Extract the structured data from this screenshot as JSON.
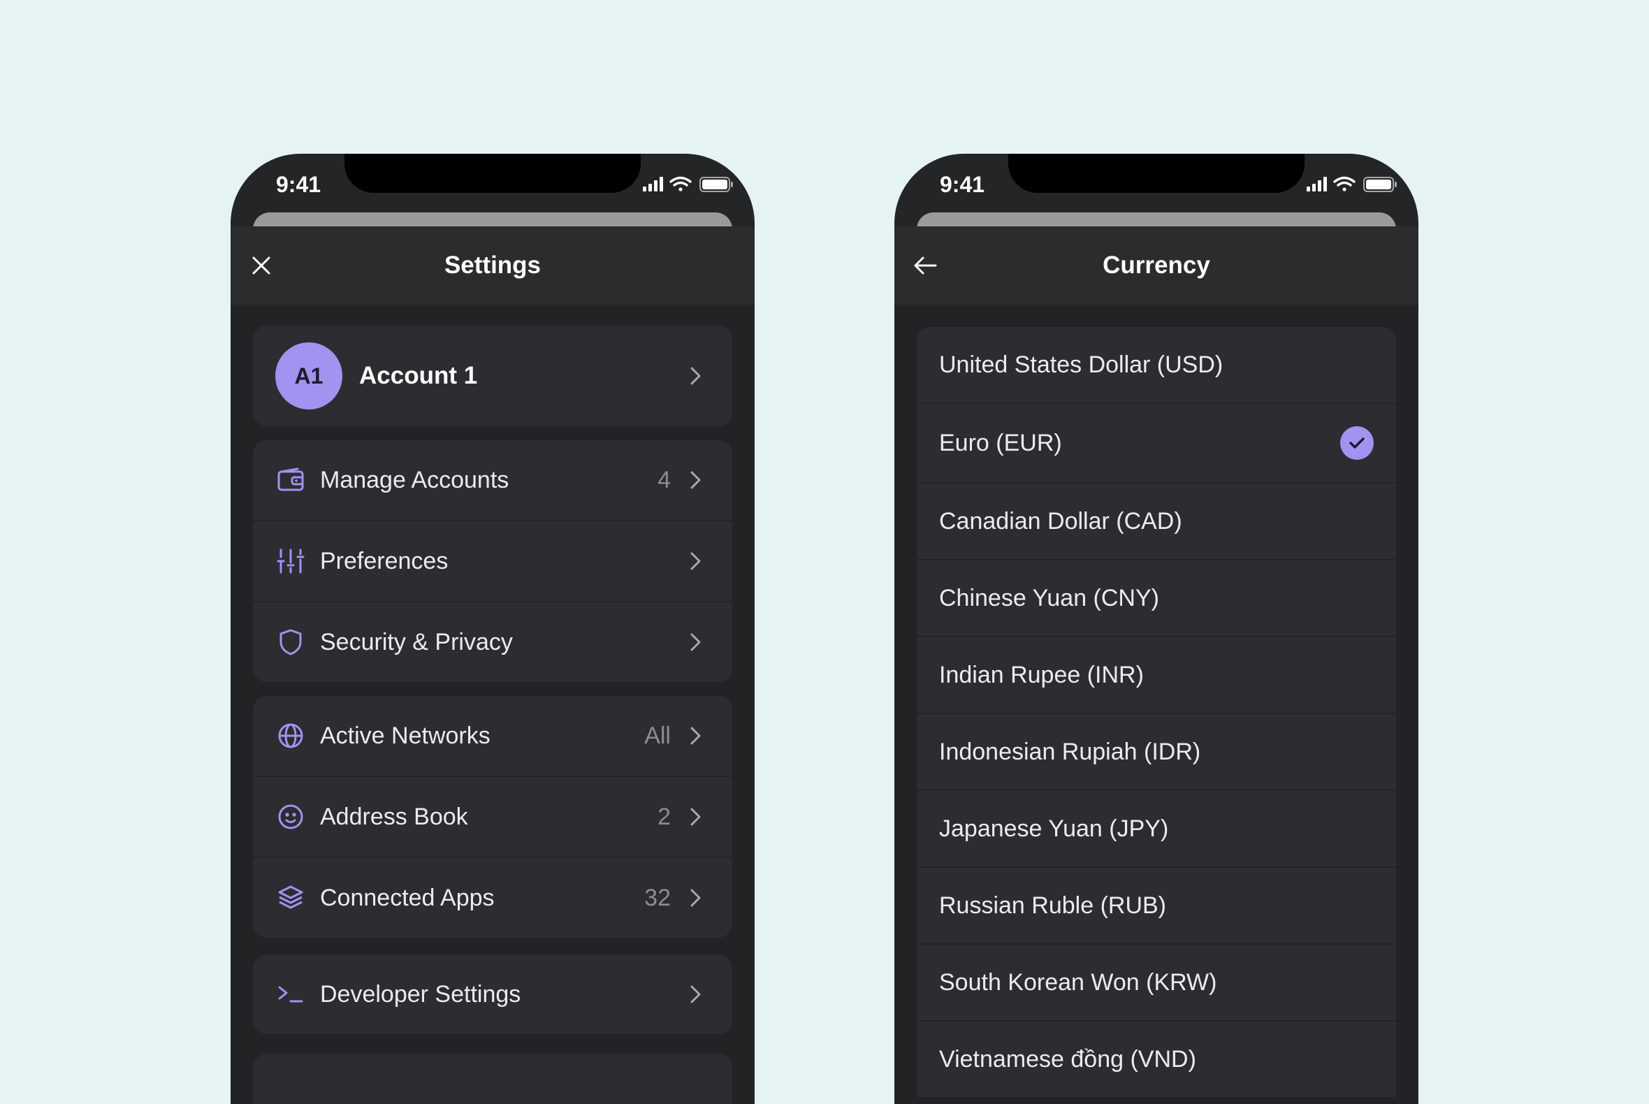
{
  "settings_screen": {
    "status_time": "9:41",
    "title": "Settings",
    "close_icon": "close-icon",
    "account": {
      "avatar_initials": "A1",
      "name": "Account 1"
    },
    "groups": [
      [
        {
          "icon": "wallet-icon",
          "label": "Manage Accounts",
          "value": "4"
        },
        {
          "icon": "sliders-icon",
          "label": "Preferences",
          "value": ""
        },
        {
          "icon": "shield-icon",
          "label": "Security & Privacy",
          "value": ""
        }
      ],
      [
        {
          "icon": "globe-icon",
          "label": "Active Networks",
          "value": "All"
        },
        {
          "icon": "smiley-icon",
          "label": "Address Book",
          "value": "2"
        },
        {
          "icon": "layers-icon",
          "label": "Connected Apps",
          "value": "32"
        }
      ],
      [
        {
          "icon": "terminal-icon",
          "label": "Developer Settings",
          "value": ""
        }
      ]
    ]
  },
  "currency_screen": {
    "status_time": "9:41",
    "title": "Currency",
    "back_icon": "arrow-left-icon",
    "selected": "Euro (EUR)",
    "items": [
      "United States Dollar (USD)",
      "Euro (EUR)",
      "Canadian Dollar (CAD)",
      "Chinese Yuan (CNY)",
      "Indian Rupee (INR)",
      "Indonesian Rupiah (IDR)",
      "Japanese Yuan (JPY)",
      "Russian Ruble (RUB)",
      "South Korean Won (KRW)",
      "Vietnamese đồng (VND)"
    ]
  },
  "colors": {
    "accent": "#a392f0",
    "background": "#e5f4f2",
    "surface": "#2c2d30"
  }
}
